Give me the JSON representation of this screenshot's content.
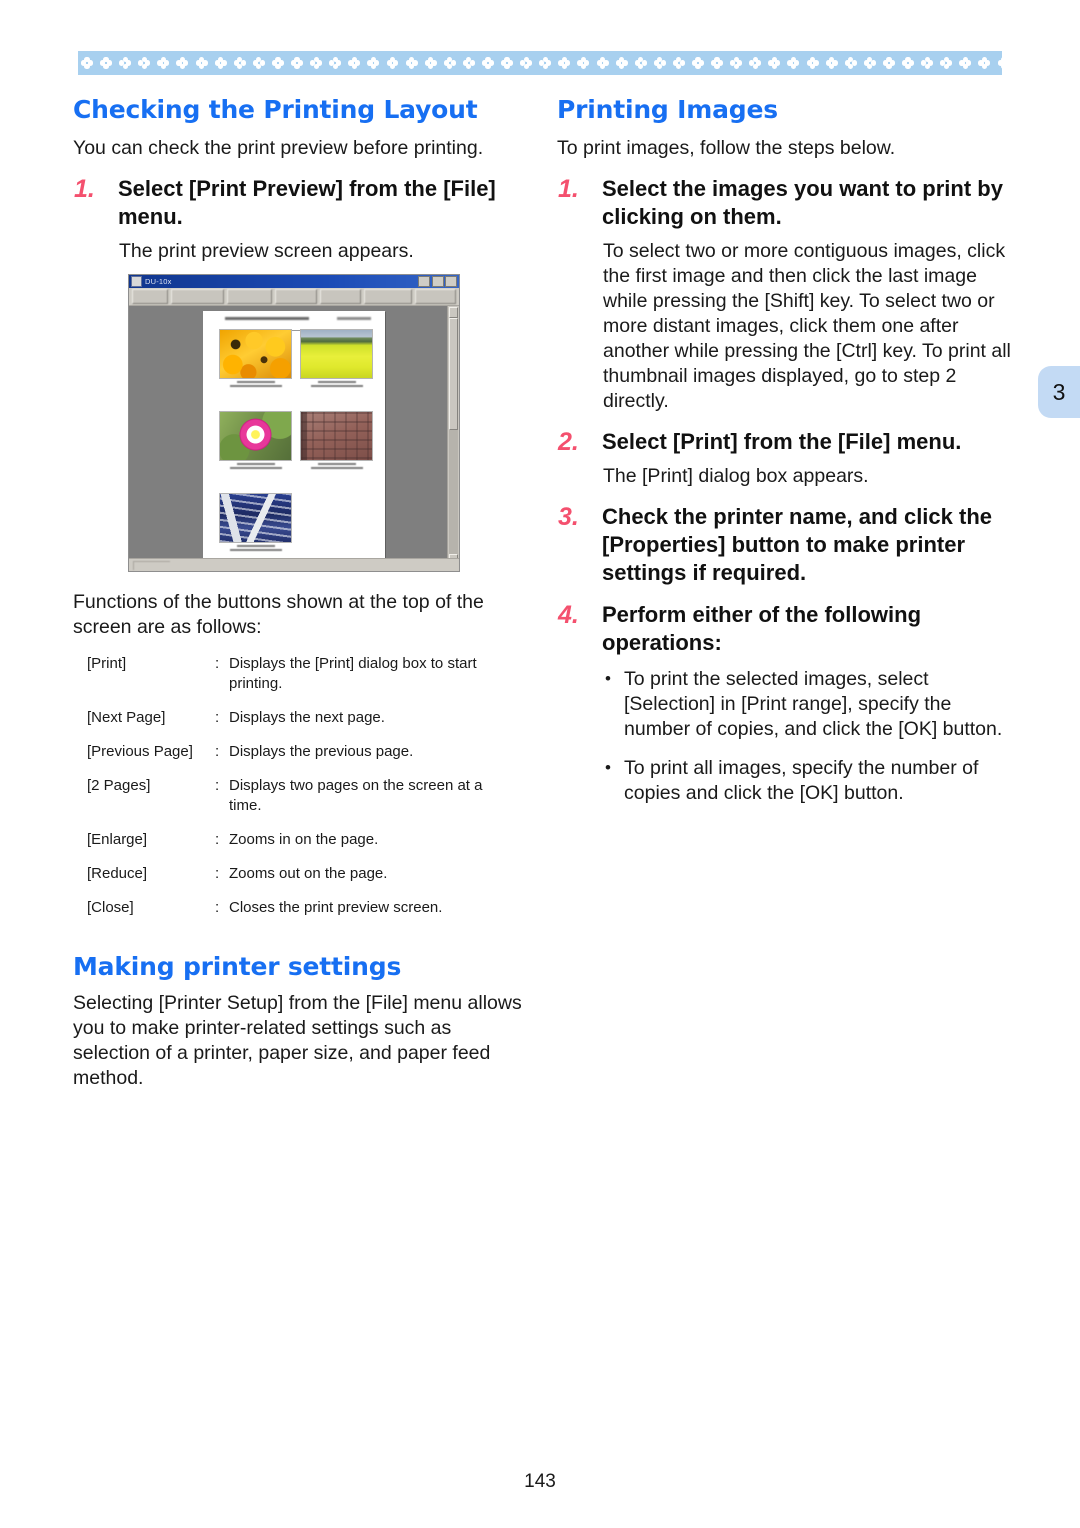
{
  "page": {
    "folio": "143",
    "chapter_tab": "3",
    "accent_blue": "#176ff2",
    "accent_pink": "#f4506e",
    "band_blue": "#a8d0ef",
    "tab_blue": "#c3daf4"
  },
  "left_column": {
    "heading": "Checking the Printing Layout",
    "intro": "You can check the print preview before printing.",
    "step1": {
      "num": "1.",
      "title": "Select [Print Preview] from the [File] menu.",
      "body": "The print preview screen appears."
    },
    "screenshot": {
      "window_title": "DU-10x",
      "toolbar_buttons": [
        "",
        "",
        "",
        "",
        "",
        "",
        ""
      ],
      "thumbnails": [
        "orange-marigold-flowers",
        "yellow-rapeseed-field",
        "pink-cosmos-flower",
        "brick-building-facade",
        "blue-office-buildings"
      ]
    },
    "functions_intro": "Functions of the buttons shown at the top of the screen are as follows:",
    "functions": [
      {
        "key": "[Print]",
        "colon": ":",
        "desc": "Displays the [Print] dialog box to start printing."
      },
      {
        "key": "[Next Page]",
        "colon": ":",
        "desc": "Displays the next page."
      },
      {
        "key": "[Previous Page]",
        "colon": ":",
        "desc": "Displays the previous page."
      },
      {
        "key": "[2 Pages]",
        "colon": ":",
        "desc": "Displays two pages on the screen at a time."
      },
      {
        "key": "[Enlarge]",
        "colon": ":",
        "desc": "Zooms in on the page."
      },
      {
        "key": "[Reduce]",
        "colon": ":",
        "desc": "Zooms out on the page."
      },
      {
        "key": "[Close]",
        "colon": ":",
        "desc": "Closes the print preview screen."
      }
    ],
    "heading2": "Making printer settings",
    "body2": "Selecting [Printer Setup] from the [File] menu allows you to make printer-related settings such as selection of a printer, paper size, and paper feed method."
  },
  "right_column": {
    "heading": "Printing Images",
    "intro": "To print images, follow the steps below.",
    "step1": {
      "num": "1.",
      "title": "Select the images you want to print by clicking on them.",
      "body": "To select two or more contiguous images, click the first image and then click the last image while pressing the [Shift] key. To select two or more distant images, click them one after another while pressing the [Ctrl] key. To print all thumbnail images displayed, go to step 2 directly."
    },
    "step2": {
      "num": "2.",
      "title": "Select [Print] from the [File] menu.",
      "body": "The [Print] dialog box appears."
    },
    "step3": {
      "num": "3.",
      "title": "Check the printer name, and click the [Properties] button to make printer settings if required."
    },
    "step4": {
      "num": "4.",
      "title": "Perform either of the following operations:",
      "bullets": [
        "To print the selected images, select [Selection] in [Print range], specify the number of copies, and click the [OK] button.",
        "To print all images, specify the number of copies and click the [OK] button."
      ]
    }
  }
}
